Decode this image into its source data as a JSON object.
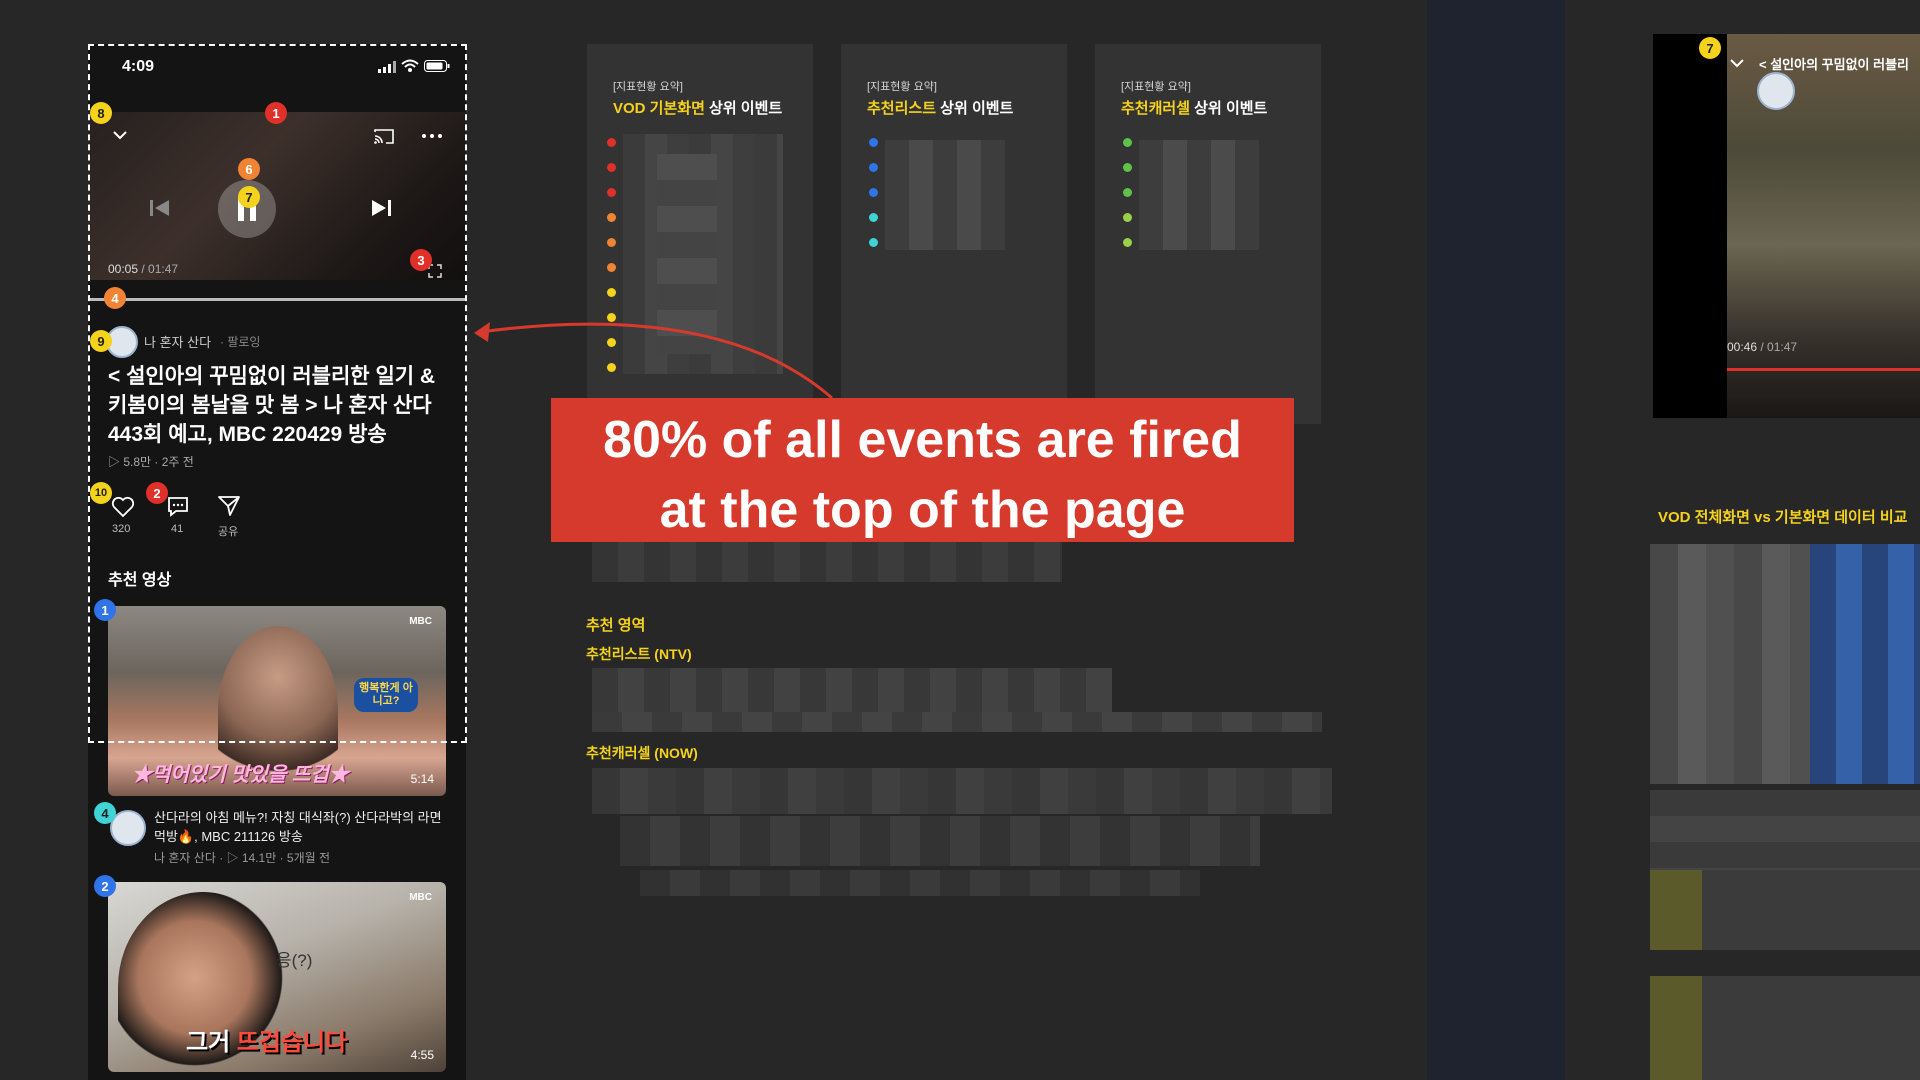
{
  "phone": {
    "status_time": "4:09",
    "time_elapsed": "00:05",
    "time_total": "01:47",
    "channel_name": "나 혼자 산다",
    "follow_label": "· 팔로잉",
    "video_title": "< 설인아의 꾸밈없이 러블리한 일기 & 키봄이의 봄날을 맛 봄 > 나 혼자 산다 443회 예고, MBC 220429 방송",
    "views_meta": "▷ 5.8만 · 2주 전",
    "like_count": "320",
    "comment_count": "41",
    "share_label": "공유",
    "recommend_heading": "추천 영상",
    "rec1_duration": "5:14",
    "rec1_thumb_text": "★먹어있기 맛있을 뜨겁★",
    "rec1_bubble": "행복한게 아니고?",
    "rec1_logo": "MBC",
    "rec_item_title": "산다라의 아침 메뉴?! 자칭 대식좌(?) 산다라박의 라면 먹방🔥, MBC 211126 방송",
    "rec_item_meta": "나 혼자 산다 · ▷ 14.1만 · 5개월 전",
    "rec2_duration": "4:55",
    "rec2_thumb_text_a": "그거",
    "rec2_thumb_text_b": "뜨겁습니다",
    "rec2_thumb_sub": "응(?)",
    "rec2_logo": "MBC"
  },
  "markers": {
    "m1": "1",
    "m2": "2",
    "m3": "3",
    "m4": "4",
    "m6": "6",
    "m7": "7",
    "m8": "8",
    "m9": "9",
    "m10": "10",
    "rec1": "1",
    "rec4": "4",
    "rec2": "2",
    "right7": "7"
  },
  "cards": [
    {
      "caption": "[지표현황 요약]",
      "title_hl": "VOD 기본화면",
      "title_rest": " 상위 이벤트"
    },
    {
      "caption": "[지표현황 요약]",
      "title_hl": "추천리스트",
      "title_rest": " 상위 이벤트"
    },
    {
      "caption": "[지표현황 요약]",
      "title_hl": "추천캐러셀",
      "title_rest": " 상위 이벤트"
    }
  ],
  "callout": {
    "line1": "80% of all events are fired",
    "line2": "at the top of the page"
  },
  "sections": {
    "rec_area": "추천 영역",
    "ntv": "추천리스트 (NTV)",
    "now": "추천캐러셀 (NOW)"
  },
  "right_panel": {
    "video_title": "< 설인아의 꾸밈없이 러블리",
    "elapsed": "00:46",
    "total": "01:47",
    "compare_heading": "VOD 전체화면 vs 기본화면  데이터 비교"
  },
  "colors": {
    "background": "#272727",
    "callout": "#d63a2c",
    "accent_yellow": "#f5d21c",
    "marker_red": "#e0302a",
    "marker_orange": "#f08434",
    "marker_blue": "#2f74e8",
    "marker_cyan": "#3fd3d6"
  }
}
